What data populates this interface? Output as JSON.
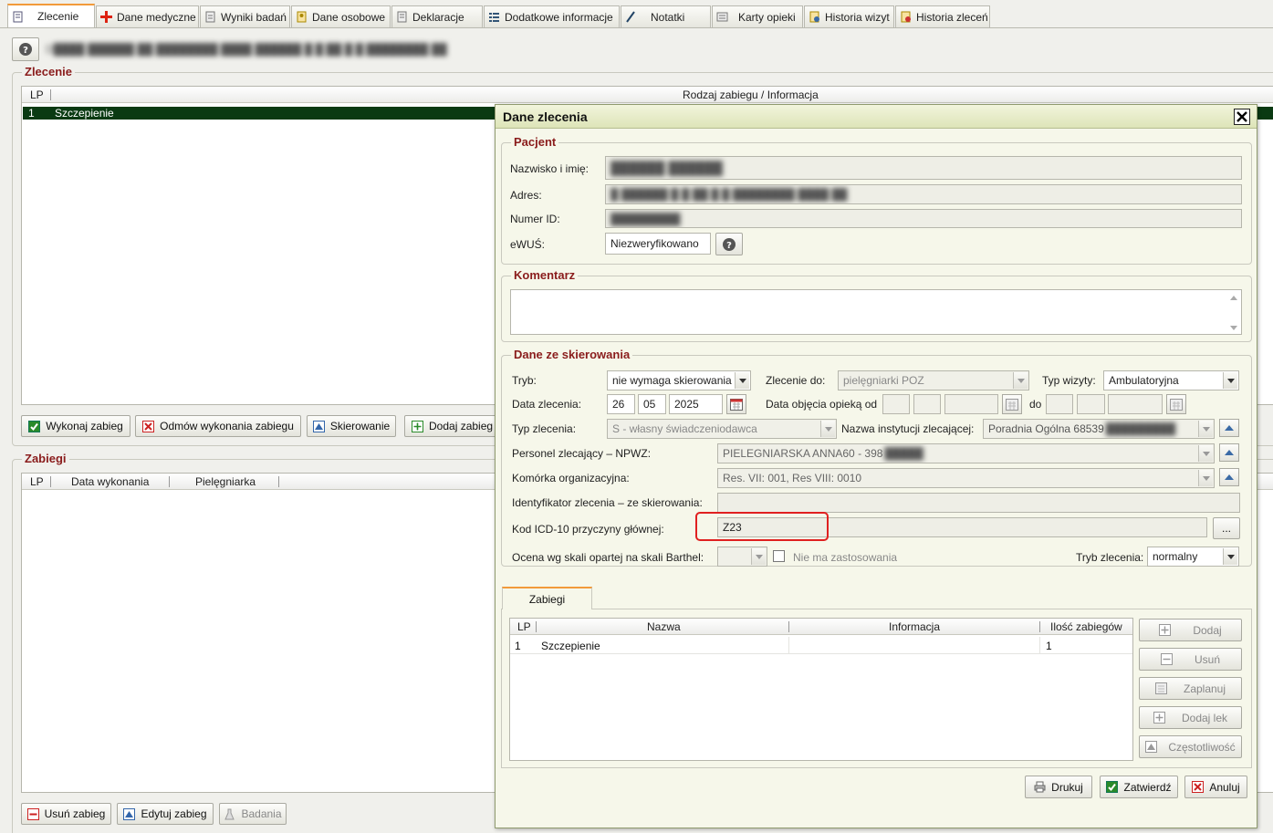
{
  "tabs": [
    {
      "label": "Zlecenie",
      "active": true
    },
    {
      "label": "Dane medyczne"
    },
    {
      "label": "Wyniki badań"
    },
    {
      "label": "Dane osobowe"
    },
    {
      "label": "Deklaracje"
    },
    {
      "label": "Dodatkowe informacje"
    },
    {
      "label": "Notatki"
    },
    {
      "label": "Karty opieki"
    },
    {
      "label": "Historia wizyt"
    },
    {
      "label": "Historia zleceń"
    }
  ],
  "header": {
    "patient_info": "D████ ██████ ██ ████████ ████ ██████ █ █ ██ █ █ ████████ ██"
  },
  "zlecenie": {
    "legend": "Zlecenie",
    "columns": {
      "lp": "LP",
      "rodzaj": "Rodzaj zabiegu / Informacja"
    },
    "rows": [
      {
        "lp": "1",
        "name": "Szczepienie"
      }
    ],
    "buttons": {
      "wykonaj": "Wykonaj zabieg",
      "odmow": "Odmów wykonania zabiegu",
      "skierowanie": "Skierowanie",
      "dodaj": "Dodaj zabieg"
    }
  },
  "zabiegi": {
    "legend": "Zabiegi",
    "columns": {
      "lp": "LP",
      "data": "Data wykonania",
      "pielegniarka": "Pielęgniarka"
    },
    "buttons": {
      "usun": "Usuń zabieg",
      "edytuj": "Edytuj zabieg",
      "badania": "Badania"
    }
  },
  "dialog": {
    "title": "Dane zlecenia",
    "pacjent": {
      "legend": "Pacjent",
      "name_label": "Nazwisko i imię:",
      "name_value": "██████ ██████",
      "address_label": "Adres:",
      "address_value": "█ ██████ █ █ ██ █ █ ████████ ████ ██",
      "id_label": "Numer ID:",
      "id_value": "█████████",
      "ewus_label": "eWUŚ:",
      "ewus_value": "Niezweryfikowano"
    },
    "komentarz": {
      "legend": "Komentarz",
      "value": ""
    },
    "skierowanie": {
      "legend": "Dane ze skierowania",
      "tryb_label": "Tryb:",
      "tryb_value": "nie wymaga skierowania",
      "zlecenie_do_label": "Zlecenie do:",
      "zlecenie_do_value": "pielęgniarki POZ",
      "typ_wizyty_label": "Typ wizyty:",
      "typ_wizyty_value": "Ambulatoryjna",
      "data_zlecenia_label": "Data zlecenia:",
      "day": "26",
      "month": "05",
      "year": "2025",
      "data_objecia_label": "Data objęcia opieką od",
      "do_label": "do",
      "typ_zlecenia_label": "Typ zlecenia:",
      "typ_zlecenia_value": "S - własny świadczeniodawca",
      "nazwa_instytucji_label": "Nazwa instytucji zlecającej:",
      "nazwa_instytucji_value": "Poradnia Ogólna 68539",
      "personel_label": "Personel zlecający – NPWZ:",
      "personel_value": "PIELEGNIARSKA ANNA60 - 398",
      "komorka_label": "Komórka organizacyjna:",
      "komorka_value": "Res. VII:  001, Res VIII: 0010",
      "identyfikator_label": "Identyfikator zlecenia – ze skierowania:",
      "icd_label": "Kod ICD-10 przyczyny głównej:",
      "icd_value": "Z23",
      "icd_button": "...",
      "barthel_label": "Ocena wg skali opartej na skali Barthel:",
      "nie_ma_zastosowania": "Nie ma zastosowania",
      "tryb_zlecenia_label": "Tryb zlecenia:",
      "tryb_zlecenia_value": "normalny"
    },
    "zabiegi_tab": {
      "label": "Zabiegi",
      "columns": {
        "lp": "LP",
        "nazwa": "Nazwa",
        "informacja": "Informacja",
        "ilosc": "Ilość zabiegów"
      },
      "rows": [
        {
          "lp": "1",
          "nazwa": "Szczepienie",
          "informacja": "",
          "ilosc": "1"
        }
      ],
      "buttons": {
        "dodaj": "Dodaj",
        "usun": "Usuń",
        "zaplanuj": "Zaplanuj",
        "dodaj_lek": "Dodaj lek",
        "czestotliwosc": "Częstotliwość"
      }
    },
    "footer": {
      "drukuj": "Drukuj",
      "zatwierdz": "Zatwierdź",
      "anuluj": "Anuluj"
    }
  }
}
